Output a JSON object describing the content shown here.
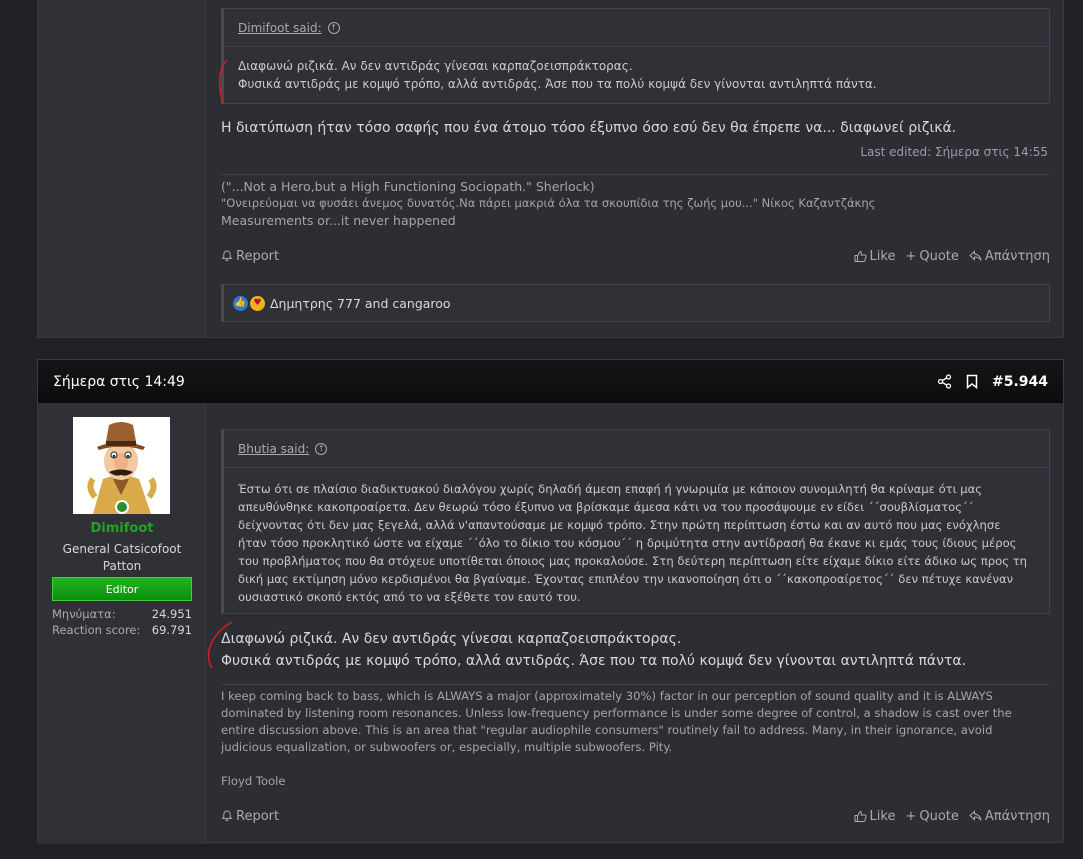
{
  "prev_post": {
    "quote": {
      "author": "Dimifoot said:",
      "lines": [
        "Διαφωνώ ριζικά. Αν δεν αντιδράς γίνεσαι καρπαζοεισπράκτορας.",
        "Φυσικά αντιδράς με κομψό τρόπο, αλλά αντιδράς. Άσε που τα πολύ κομψά δεν γίνονται αντιληπτά πάντα."
      ]
    },
    "text": "Η διατύπωση ήταν τόσο σαφής που ένα άτομο τόσο έξυπνο όσο εσύ δεν θα έπρεπε να... διαφωνεί ριζικά.",
    "last_edited": "Last edited: Σήμερα στις 14:55",
    "signature": [
      "(\"...Not a Hero,but a High Functioning Sociopath.\" Sherlock)",
      "\"Ονειρεύομαι να φυσάει άνεμος δυνατός.Να πάρει μακριά όλα τα σκουπίδια της ζωής μου...\" Νίκος Καζαντζάκης",
      "Measurements or...it never happened"
    ],
    "footer": {
      "report": "Report",
      "like": "Like",
      "quote": "Quote",
      "reply": "Απάντηση"
    },
    "reactions": {
      "text": "Δημητρης 777 and cangaroo",
      "icons": [
        "like",
        "love"
      ]
    }
  },
  "main_post": {
    "header": {
      "date": "Σήμερα στις 14:49",
      "post_number": "#5.944"
    },
    "user": {
      "name": "Dimifoot",
      "title": "General Catsicofoot Patton",
      "badge": "Editor",
      "stats": [
        {
          "label": "Μηνύματα:",
          "value": "24.951"
        },
        {
          "label": "Reaction score:",
          "value": "69.791"
        }
      ]
    },
    "quote": {
      "author": "Bhutia said:",
      "lines": [
        "Έστω ότι σε πλαίσιο διαδικτυακού διαλόγου χωρίς δηλαδή άμεση επαφή ή γνωριμία με κάποιον συνομιλητή θα κρίναμε ότι μας",
        "απευθύνθηκε κακοπροαίρετα. Δεν θεωρώ τόσο έξυπνο να βρίσκαμε άμεσα κάτι να του προσάψουμε εν είδει ΄΄σουβλίσματος΄΄",
        "δείχνοντας ότι δεν μας ξεγελά, αλλά ν'απαντούσαμε με κομψό τρόπο. Στην πρώτη περίπτωση έστω και αν αυτό που μας ενόχλησε",
        "ήταν τόσο προκλητικό ώστε να είχαμε ΄΄όλο το δίκιο του κόσμου΄΄ η δριμύτητα στην αντίδρασή θα έκανε κι εμάς τους ίδιους μέρος",
        "του προβλήματος που θα στόχευε υποτίθεται όποιος μας προκαλούσε. Στη δεύτερη περίπτωση είτε είχαμε δίκιο είτε άδικο ως προς τη",
        "δική μας εκτίμηση μόνο κερδισμένοι θα βγαίναμε. Έχοντας επιπλέον την ικανοποίηση ότι ο ΄΄κακοπροαίρετος΄΄ δεν πέτυχε κανέναν",
        "ουσιαστικό σκοπό εκτός από το να εξέθετε τον εαυτό του."
      ]
    },
    "text_lines": [
      "Διαφωνώ ριζικά. Αν δεν αντιδράς γίνεσαι καρπαζοεισπράκτορας.",
      "Φυσικά αντιδράς με κομψό τρόπο, αλλά αντιδράς. Άσε που τα πολύ κομψά δεν γίνονται αντιληπτά πάντα."
    ],
    "signature": [
      "I keep coming back to bass, which is ALWAYS a major (approximately 30%) factor in our perception of sound quality and it is ALWAYS",
      "dominated by listening room resonances. Unless low-frequency performance is under some degree of control, a shadow is cast over the",
      "entire discussion above. This is an area that \"regular audiophile consumers\" routinely fail to address. Many, in their ignorance, avoid",
      "judicious equalization, or subwoofers or, especially, multiple subwoofers. Pity.",
      "",
      "Floyd Toole"
    ],
    "footer": {
      "report": "Report",
      "like": "Like",
      "quote": "Quote",
      "reply": "Απάντηση"
    }
  },
  "colors": {
    "annotation": "#c8202a",
    "username": "#23a323",
    "badge": "#14a014"
  }
}
